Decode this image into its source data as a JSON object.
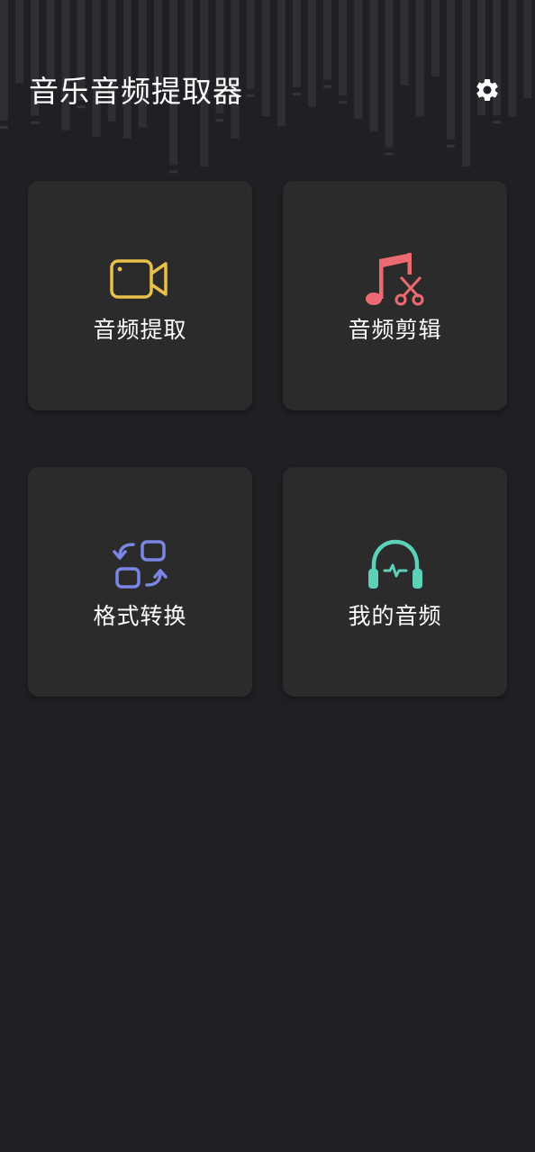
{
  "app": {
    "title": "音乐音频提取器"
  },
  "header": {
    "settings_icon": "gear-icon"
  },
  "cards": [
    {
      "label": "音频提取",
      "icon": "video-camera-icon",
      "color": "#e8c14a"
    },
    {
      "label": "音频剪辑",
      "icon": "music-scissors-icon",
      "color": "#ec6a72"
    },
    {
      "label": "格式转换",
      "icon": "format-convert-icon",
      "color": "#7b86e6"
    },
    {
      "label": "我的音频",
      "icon": "headphones-icon",
      "color": "#5cd0b8"
    }
  ],
  "theme": {
    "background": "#1f2023",
    "card": "#2b2b2c",
    "text": "#ffffff"
  }
}
